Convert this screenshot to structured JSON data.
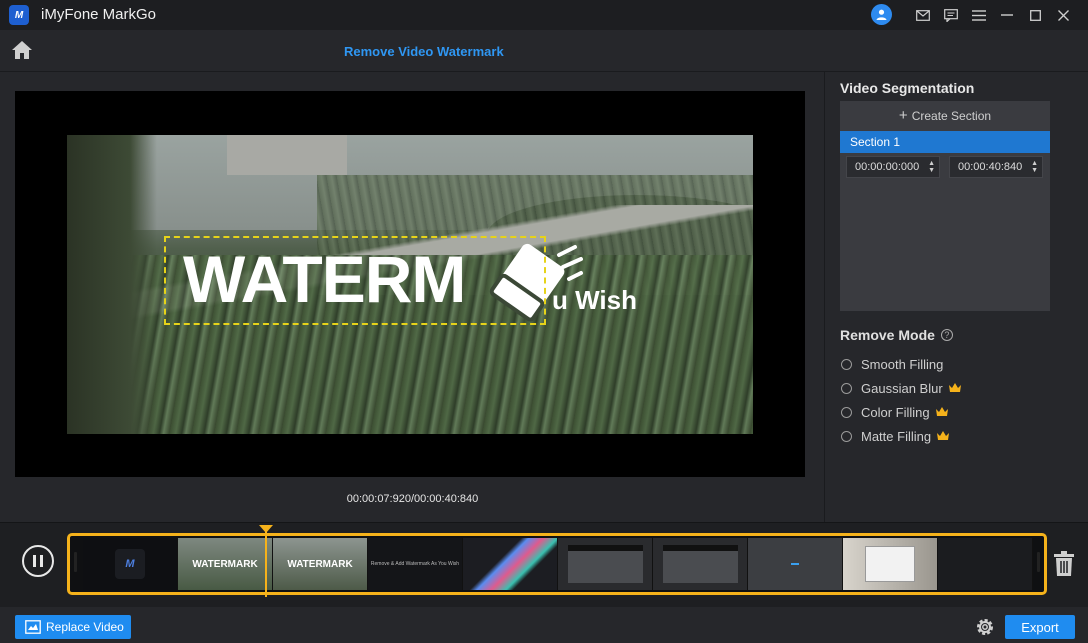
{
  "app": {
    "title": "iMyFone MarkGo",
    "logo_text": "M"
  },
  "titlebar": {
    "icons": [
      "user-avatar-icon",
      "mail-icon",
      "feedback-icon",
      "menu-icon",
      "minimize-icon",
      "maximize-icon",
      "close-icon"
    ]
  },
  "header": {
    "page_title": "Remove Video Watermark"
  },
  "preview": {
    "watermark_text": "WATERM",
    "watermark_subtext": "u Wish",
    "timecode": "00:00:07:920/00:00:40:840"
  },
  "segmentation": {
    "title": "Video Segmentation",
    "create_label": "Create Section",
    "sections": [
      {
        "label": "Section 1",
        "start": "00:00:00:000",
        "end": "00:00:40:840"
      }
    ]
  },
  "remove_mode": {
    "title": "Remove Mode",
    "options": [
      {
        "label": "Smooth Filling",
        "premium": false
      },
      {
        "label": "Gaussian Blur",
        "premium": true
      },
      {
        "label": "Color Filling",
        "premium": true
      },
      {
        "label": "Matte Filling",
        "premium": true
      }
    ]
  },
  "timeline": {
    "thumb_texts": [
      "",
      "",
      "WATERMARK",
      "WATERMARK",
      "Remove & Add Watermark As You Wish",
      "",
      "",
      "",
      "",
      "",
      ""
    ]
  },
  "bottom": {
    "replace_label": "Replace Video",
    "export_label": "Export"
  },
  "colors": {
    "accent": "#1f8cf0",
    "highlight": "#f5b21b",
    "title_blue": "#2f97f3"
  }
}
